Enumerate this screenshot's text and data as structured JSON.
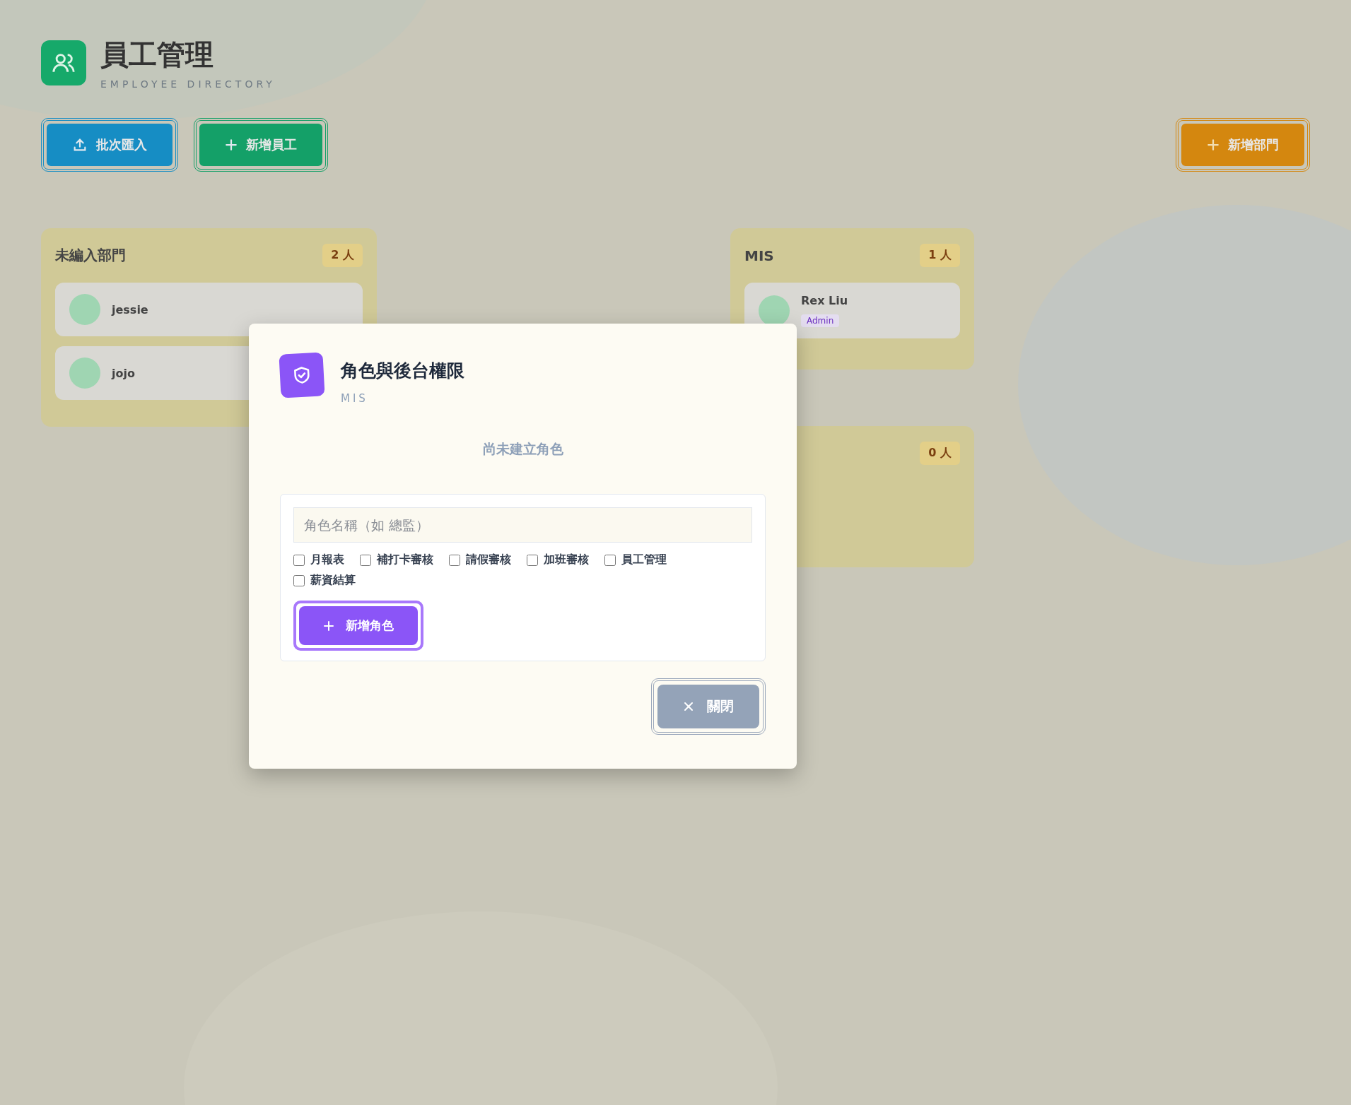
{
  "header": {
    "title": "員工管理",
    "subtitle": "EMPLOYEE DIRECTORY"
  },
  "toolbar": {
    "left_buttons": [
      {
        "label": "批次匯入",
        "kind": "import"
      },
      {
        "label": "新增員工",
        "kind": "add"
      }
    ],
    "right_button": {
      "label": "新增部門"
    }
  },
  "departments": [
    {
      "name": "未編入部門",
      "count": "2 人",
      "members": [
        {
          "name": "jessie"
        },
        {
          "name": "jojo"
        }
      ]
    },
    {
      "name": "MIS",
      "count": "1 人",
      "members": [
        {
          "name": "Rex Liu",
          "role": "Admin"
        }
      ]
    },
    {
      "count": "0 人"
    }
  ],
  "dialog": {
    "title": "角色與後台權限",
    "subtitle": "MIS",
    "empty_message": "尚未建立角色",
    "role_name": {
      "placeholder": "角色名稱（如 總監）"
    },
    "permissions": [
      {
        "label": "月報表",
        "checked": false
      },
      {
        "label": "補打卡審核",
        "checked": false
      },
      {
        "label": "請假審核",
        "checked": false
      },
      {
        "label": "加班審核",
        "checked": false
      },
      {
        "label": "員工管理",
        "checked": false
      },
      {
        "label": "薪資結算",
        "checked": false
      }
    ],
    "add_button": "新增角色",
    "close_button": "關閉"
  }
}
